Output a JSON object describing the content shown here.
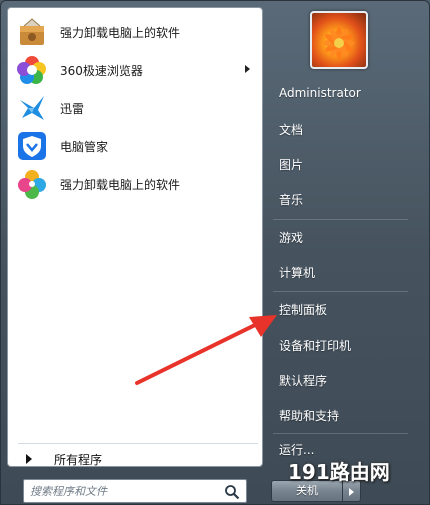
{
  "programs": [
    {
      "label": "强力卸载电脑上的软件",
      "icon": "uninstaller-box-icon"
    },
    {
      "label": "360极速浏览器",
      "icon": "360-browser-icon",
      "has_submenu": true
    },
    {
      "label": "迅雷",
      "icon": "xunlei-bird-icon"
    },
    {
      "label": "电脑管家",
      "icon": "pc-manager-shield-icon"
    },
    {
      "label": "强力卸载电脑上的软件",
      "icon": "uninstaller-petal-icon"
    }
  ],
  "all_programs": "所有程序",
  "search": {
    "placeholder": "搜索程序和文件"
  },
  "right_items": {
    "user": "Administrator",
    "documents": "文档",
    "pictures": "图片",
    "music": "音乐",
    "games": "游戏",
    "computer": "计算机",
    "control_panel": "控制面板",
    "devices_printers": "设备和打印机",
    "default_programs": "默认程序",
    "help_support": "帮助和支持",
    "run": "运行..."
  },
  "shutdown": "关机",
  "watermark": "191路由网",
  "colors": {
    "annotation_arrow": "#e8332a",
    "menu_bg": "#4e5c69"
  }
}
